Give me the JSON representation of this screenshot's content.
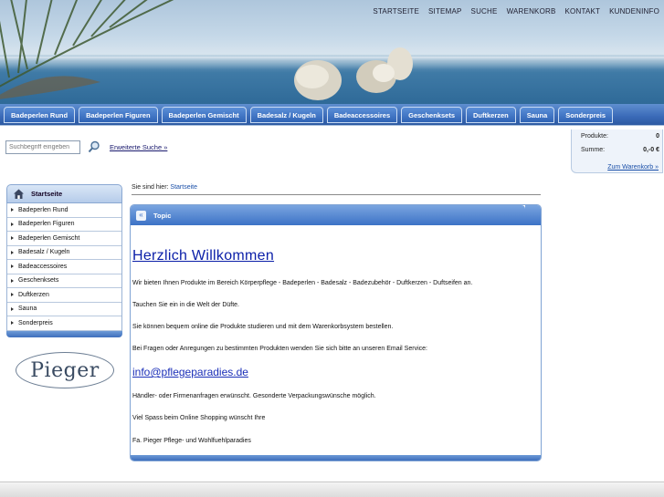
{
  "topnav": [
    "STARTSEITE",
    "SITEMAP",
    "SUCHE",
    "WARENKORB",
    "KONTAKT",
    "KUNDENINFO"
  ],
  "categories": [
    "Badeperlen Rund",
    "Badeperlen Figuren",
    "Badeperlen Gemischt",
    "Badesalz / Kugeln",
    "Badeaccessoires",
    "Geschenksets",
    "Duftkerzen",
    "Sauna",
    "Sonderpreis"
  ],
  "search": {
    "placeholder": "Suchbegriff eingeben",
    "advanced_label": "Erweiterte Suche »"
  },
  "cart": {
    "products_label": "Produkte:",
    "products_value": "0",
    "sum_label": "Summe:",
    "sum_value": "0,-0 €",
    "link_label": "Zum Warenkorb »"
  },
  "sidebar": {
    "title": "Startseite",
    "items": [
      "Badeperlen Rund",
      "Badeperlen Figuren",
      "Badeperlen Gemischt",
      "Badesalz / Kugeln",
      "Badeaccessoires",
      "Geschenksets",
      "Duftkerzen",
      "Sauna",
      "Sonderpreis"
    ]
  },
  "logo": {
    "text": "Pieger"
  },
  "breadcrumb": {
    "prefix": "Sie sind hier:",
    "link": "Startseite"
  },
  "content": {
    "topic": "Topic",
    "heading": "Herzlich Willkommen",
    "paragraphs": [
      "Wir bieten Ihnen Produkte im Bereich Körperpflege - Badeperlen - Badesalz - Badezubehör - Duftkerzen - Duftseifen an.",
      "Tauchen Sie ein in die Welt der Düfte.",
      "Sie können bequem online die Produkte studieren und mit dem Warenkorbsystem bestellen.",
      "Bei Fragen oder Anregungen zu bestimmten Produkten wenden Sie sich bitte an unseren Email Service:"
    ],
    "email": "info@pflegeparadies.de",
    "paragraphs2": [
      "Händler- oder Firmenanfragen erwünscht. Gesonderte Verpackungswünsche möglich.",
      "Viel Spass beim Online Shopping wünscht Ihre",
      "Fa. Pieger Pflege- und Wohlfuehlparadies"
    ]
  },
  "colors": {
    "accent": "#3a6ab8",
    "link": "#1a4fa8",
    "heading": "#0a1ea8"
  }
}
